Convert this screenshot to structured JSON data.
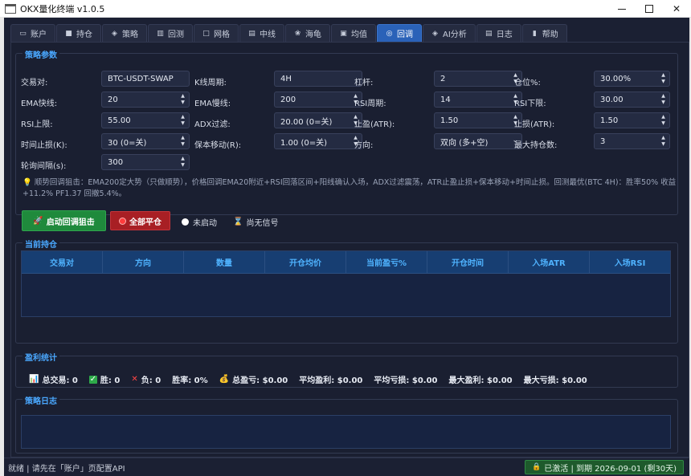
{
  "window": {
    "title": "OKX量化终端 v1.0.5",
    "controls": {
      "minimize": "—",
      "maximize": "□",
      "close": "✕"
    }
  },
  "tabs": [
    {
      "label": "账户",
      "icon": "wallet-icon",
      "glyph": "▭"
    },
    {
      "label": "持仓",
      "icon": "package-icon",
      "glyph": "■"
    },
    {
      "label": "策略",
      "icon": "shield-icon",
      "glyph": "◈"
    },
    {
      "label": "回测",
      "icon": "bar-chart-icon",
      "glyph": "▥"
    },
    {
      "label": "网格",
      "icon": "grid-icon",
      "glyph": "□"
    },
    {
      "label": "中线",
      "icon": "line-chart-icon",
      "glyph": "▤"
    },
    {
      "label": "海龟",
      "icon": "turtle-icon",
      "glyph": "❀"
    },
    {
      "label": "均值",
      "icon": "average-icon",
      "glyph": "▣"
    },
    {
      "label": "回调",
      "icon": "target-icon",
      "glyph": "◎",
      "active": true
    },
    {
      "label": "AI分析",
      "icon": "ai-shield-icon",
      "glyph": "◈"
    },
    {
      "label": "日志",
      "icon": "log-icon",
      "glyph": "▤"
    },
    {
      "label": "帮助",
      "icon": "book-icon",
      "glyph": "▮"
    }
  ],
  "params": {
    "title": "策略参数",
    "pair": {
      "label": "交易对:",
      "value": "BTC-USDT-SWAP"
    },
    "kline": {
      "label": "K线周期:",
      "value": "4H"
    },
    "leverage": {
      "label": "杠杆:",
      "value": "2"
    },
    "position": {
      "label": "仓位%:",
      "value": "30.00%"
    },
    "ema_fast": {
      "label": "EMA快线:",
      "value": "20"
    },
    "ema_slow": {
      "label": "EMA慢线:",
      "value": "200"
    },
    "rsi_period": {
      "label": "RSI周期:",
      "value": "14"
    },
    "rsi_lower": {
      "label": "RSI下限:",
      "value": "30.00"
    },
    "rsi_upper": {
      "label": "RSI上限:",
      "value": "55.00"
    },
    "adx": {
      "label": "ADX过滤:",
      "value": "20.00 (0=关)"
    },
    "take_profit": {
      "label": "止盈(ATR):",
      "value": "1.50"
    },
    "stop_loss": {
      "label": "止损(ATR):",
      "value": "1.50"
    },
    "time_stop": {
      "label": "时间止损(K):",
      "value": "30 (0=关)"
    },
    "breakeven": {
      "label": "保本移动(R):",
      "value": "1.00 (0=关)"
    },
    "direction": {
      "label": "方向:",
      "value": "双向 (多+空)"
    },
    "max_pos": {
      "label": "最大持仓数:",
      "value": "3"
    },
    "poll": {
      "label": "轮询间隔(s):",
      "value": "300"
    },
    "hint_line1": "顺势回调狙击：EMA200定大势（只做顺势），价格回调EMA20附近+RSI回落区间+阳线确认入场，ADX过滤震荡，ATR止盈止损+保本移动+时间止损。回测最优(BTC 4H)：胜率50% 收益",
    "hint_line2": "+11.2% PF1.37 回撤5.4%。"
  },
  "actions": {
    "start": "启动回调狙击",
    "close_all": "全部平仓",
    "run_status": "未启动",
    "signal_status": "尚无信号"
  },
  "positions": {
    "title": "当前持仓",
    "columns": [
      "交易对",
      "方向",
      "数量",
      "开仓均价",
      "当前盈亏%",
      "开仓时间",
      "入场ATR",
      "入场RSI"
    ]
  },
  "stats": {
    "title": "盈利统计",
    "items": [
      {
        "label": "总交易: 0",
        "icon": "chart-icon"
      },
      {
        "label": "胜: 0",
        "icon": "check-icon"
      },
      {
        "label": "负: 0",
        "icon": "x-icon"
      },
      {
        "label": "胜率: 0%",
        "icon": ""
      },
      {
        "label": "总盈亏: $0.00",
        "icon": "money-bag-icon"
      },
      {
        "label": "平均盈利: $0.00",
        "icon": ""
      },
      {
        "label": "平均亏损: $0.00",
        "icon": ""
      },
      {
        "label": "最大盈利: $0.00",
        "icon": ""
      },
      {
        "label": "最大亏损: $0.00",
        "icon": ""
      }
    ]
  },
  "log": {
    "title": "策略日志"
  },
  "statusbar": {
    "left": "就绪 | 请先在「账户」页配置API",
    "license": "已激活 | 到期 2026-09-01 (剩30天)"
  },
  "colors": {
    "background": "#1b2033",
    "accent": "#4aa8ff",
    "active_tab": "#2a62b8",
    "start_button": "#1f8a3c",
    "close_button": "#a81f24"
  }
}
